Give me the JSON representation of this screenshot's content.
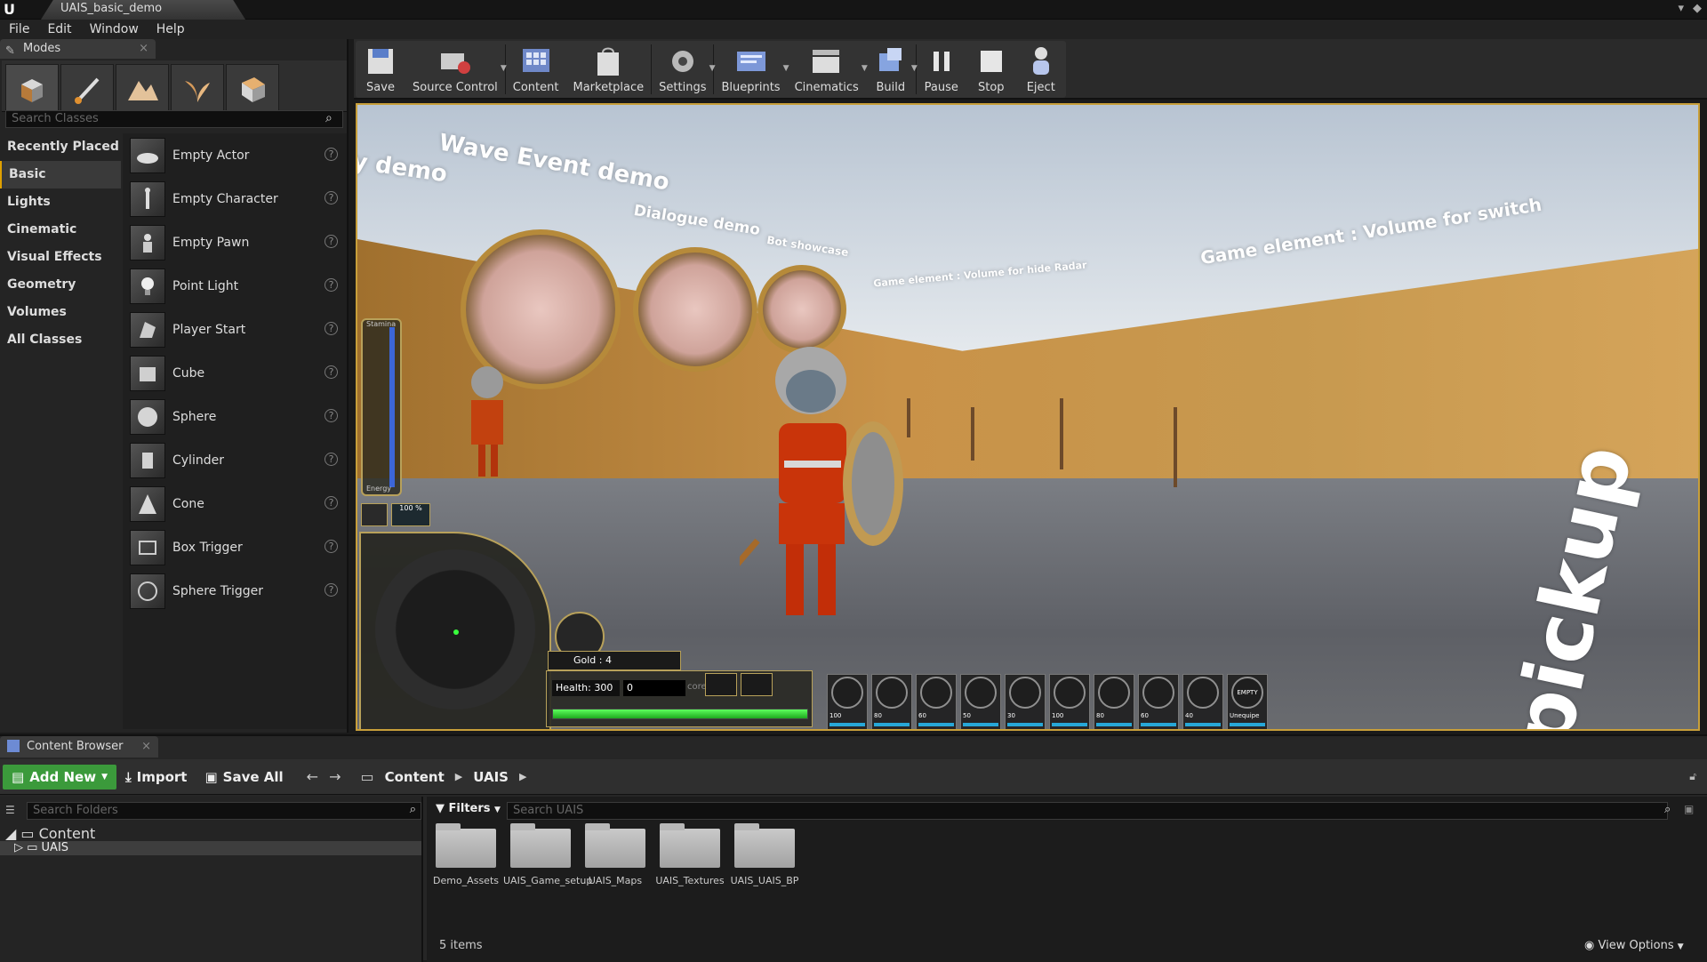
{
  "window": {
    "tab_title": "UAIS_basic_demo"
  },
  "menu": [
    "File",
    "Edit",
    "Window",
    "Help"
  ],
  "modes_panel": {
    "tab_label": "Modes",
    "search_placeholder": "Search Classes",
    "categories": [
      "Recently Placed",
      "Basic",
      "Lights",
      "Cinematic",
      "Visual Effects",
      "Geometry",
      "Volumes",
      "All Classes"
    ],
    "active_category": "Basic",
    "classes": [
      "Empty Actor",
      "Empty Character",
      "Empty Pawn",
      "Point Light",
      "Player Start",
      "Cube",
      "Sphere",
      "Cylinder",
      "Cone",
      "Box Trigger",
      "Sphere Trigger"
    ],
    "mode_tools": [
      "place-mode-icon",
      "paint-mode-icon",
      "landscape-mode-icon",
      "foliage-mode-icon",
      "geometry-mode-icon"
    ]
  },
  "toolbar": {
    "buttons": [
      {
        "label": "Save",
        "icon": "save-icon"
      },
      {
        "label": "Source Control",
        "icon": "source-control-icon"
      },
      {
        "label": "Content",
        "icon": "content-icon"
      },
      {
        "label": "Marketplace",
        "icon": "marketplace-icon"
      },
      {
        "label": "Settings",
        "icon": "settings-icon"
      },
      {
        "label": "Blueprints",
        "icon": "blueprints-icon"
      },
      {
        "label": "Cinematics",
        "icon": "cinematics-icon"
      },
      {
        "label": "Build",
        "icon": "build-icon"
      },
      {
        "label": "Pause",
        "icon": "pause-icon"
      },
      {
        "label": "Stop",
        "icon": "stop-icon"
      },
      {
        "label": "Eject",
        "icon": "eject-icon"
      }
    ]
  },
  "viewport": {
    "signs": {
      "demo": "y demo",
      "wave": "Wave Event demo",
      "dialogue": "Dialogue demo",
      "bot": "Bot showcase",
      "hide_radar": "Game element : Volume for hide Radar",
      "switch": "Game element : Volume for switch",
      "pickup": "pickup"
    },
    "hud": {
      "stamina_label": "Stamina",
      "energy_label": "Energy",
      "small_value": "100 %",
      "gold": "Gold : 4",
      "health": "Health: 300",
      "score": "0",
      "score_label": "core",
      "health_fill": 1.0,
      "slots": [
        {
          "label": "",
          "value": "100"
        },
        {
          "label": "",
          "value": "80"
        },
        {
          "label": "",
          "value": "60"
        },
        {
          "label": "",
          "value": "50"
        },
        {
          "label": "",
          "value": "30"
        },
        {
          "label": "",
          "value": "100"
        },
        {
          "label": "",
          "value": "80"
        },
        {
          "label": "",
          "value": "60"
        },
        {
          "label": "",
          "value": "40"
        },
        {
          "label": "EMPTY",
          "value": "Unequipe"
        }
      ]
    }
  },
  "content_browser": {
    "tab_label": "Content Browser",
    "add_new": "Add New",
    "import": "Import",
    "save_all": "Save All",
    "breadcrumbs": [
      "Content",
      "UAIS"
    ],
    "search_folders_placeholder": "Search Folders",
    "tree": {
      "root": "Content",
      "child": "UAIS"
    },
    "filters_label": "Filters",
    "search_placeholder": "Search UAIS",
    "folders": [
      "Demo_Assets",
      "UAIS_Game_setup",
      "UAIS_Maps",
      "UAIS_Textures",
      "UAIS_UAIS_BP"
    ],
    "folder_display": [
      "Demo_Assets",
      "UAIS_Game_\nsetup",
      "UAIS_Maps",
      "UAIS_\nTextures",
      "UAIS_UAIS_\nBP"
    ],
    "item_count": "5 items",
    "view_options": "View Options"
  }
}
